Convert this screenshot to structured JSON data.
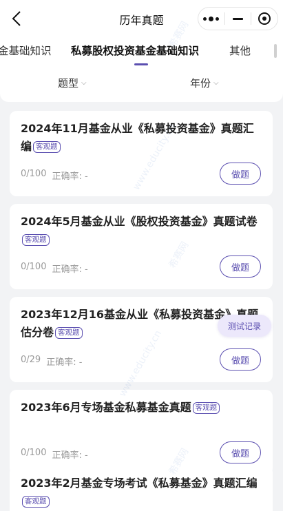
{
  "nav": {
    "title": "历年真题"
  },
  "tabs": [
    {
      "label": "金基础知识"
    },
    {
      "label": "私募股权投资基金基础知识",
      "active": true
    },
    {
      "label": "其他"
    }
  ],
  "filters": {
    "type_label": "题型",
    "year_label": "年份"
  },
  "cards": [
    {
      "title": "2024年11月基金从业《私募投资基金》真题汇编",
      "tag": "客观题",
      "progress": "0/100",
      "accuracy": "正确率: -",
      "button": "做题"
    },
    {
      "title": "2024年5月基金从业《股权投资基金》真题试卷",
      "tag": "客观题",
      "progress": "0/100",
      "accuracy": "正确率: -",
      "button": "做题"
    },
    {
      "title": "2023年12月16基金从业《私募投资基金》真题估分卷",
      "tag": "客观题",
      "progress": "0/29",
      "accuracy": "正确率: -",
      "button": "做题"
    },
    {
      "title": "2023年6月专场基金私募基金真题",
      "tag": "客观题",
      "progress": "0/100",
      "accuracy": "正确率: -",
      "button": "做题"
    },
    {
      "title": "2023年2月基金专场考试《私募基金》真题汇编",
      "tag": "客观题",
      "progress": "",
      "accuracy": "",
      "button": ""
    }
  ],
  "float_button": "测试记录",
  "colors": {
    "accent": "#5b4fb0",
    "background": "#f2f3f5"
  },
  "watermark": {
    "text_cn": "希赛网",
    "text_url": "www.educity.cn"
  }
}
